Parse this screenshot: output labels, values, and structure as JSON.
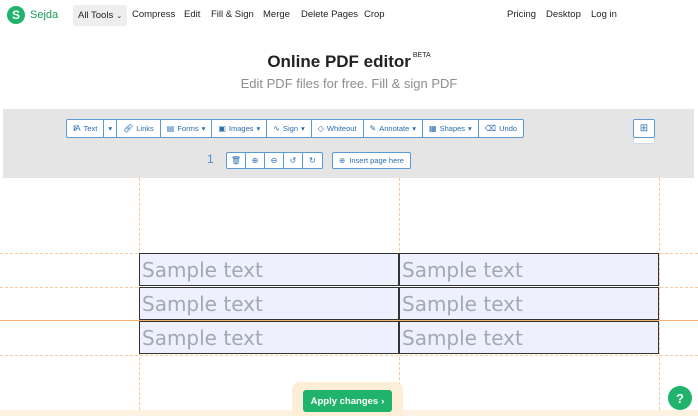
{
  "brand": {
    "logo_letter": "S",
    "name": "Sejda",
    "color": "#1fb36b"
  },
  "nav": {
    "all_tools": "All Tools",
    "items": [
      "Compress",
      "Edit",
      "Fill & Sign",
      "Merge",
      "Delete Pages",
      "Crop"
    ],
    "right": [
      "Pricing",
      "Desktop",
      "Log in"
    ]
  },
  "hero": {
    "title": "Online PDF editor",
    "badge": "BETA",
    "subtitle": "Edit PDF files for free. Fill & sign PDF"
  },
  "toolbar": {
    "text": "Text",
    "links": "Links",
    "forms": "Forms",
    "images": "Images",
    "sign": "Sign",
    "whiteout": "Whiteout",
    "annotate": "Annotate",
    "shapes": "Shapes",
    "undo": "Undo"
  },
  "page": {
    "number": "1",
    "insert_label": "Insert page here"
  },
  "cells": [
    "Sample text",
    "Sample text",
    "Sample text",
    "Sample text",
    "Sample text",
    "Sample text"
  ],
  "apply": {
    "label": "Apply changes"
  },
  "help": {
    "label": "?"
  },
  "icons": [
    "text-icon",
    "link-icon",
    "forms-icon",
    "image-icon",
    "sign-icon",
    "eraser-icon",
    "pen-icon",
    "shapes-icon",
    "undo-icon",
    "grid-icon",
    "trash-icon",
    "zoom-in-icon",
    "zoom-out-icon",
    "rotate-left-icon",
    "rotate-right-icon",
    "plus-circle-icon",
    "chevron-right-icon"
  ]
}
